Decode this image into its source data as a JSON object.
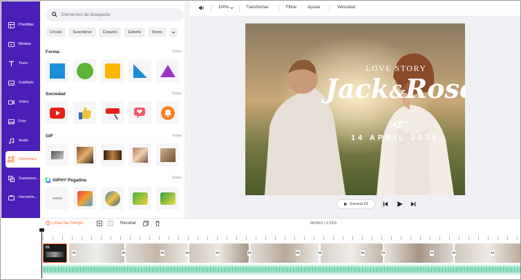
{
  "search": {
    "placeholder": "Elementos de búsqueda"
  },
  "nav": [
    {
      "label": "Plantillas",
      "icon": "templates-icon"
    },
    {
      "label": "Medios",
      "icon": "media-icon"
    },
    {
      "label": "Texto",
      "icon": "text-icon"
    },
    {
      "label": "Subtítulo",
      "icon": "subtitle-icon"
    },
    {
      "label": "Vídeo",
      "icon": "video-icon"
    },
    {
      "label": "Foto",
      "icon": "photo-icon"
    },
    {
      "label": "Audio",
      "icon": "audio-icon"
    },
    {
      "label": "Elementos",
      "icon": "elements-icon"
    },
    {
      "label": "Superposi...",
      "icon": "overlay-icon"
    },
    {
      "label": "Herramie...",
      "icon": "tools-icon"
    }
  ],
  "chips": [
    "Círculo",
    "Suscribirse",
    "Corazón",
    "Estrella",
    "Flores"
  ],
  "sections": {
    "forma": {
      "title": "Forma",
      "all": "Todas"
    },
    "sociedad": {
      "title": "Sociedad",
      "all": "Todas"
    },
    "gif": {
      "title": "GIF",
      "all": "Todas"
    },
    "giphy": {
      "title": "GIPHY Pegatina",
      "all": "Todas"
    }
  },
  "toolbar": {
    "zoom": "100%",
    "transform": "Transformar",
    "crop": "Filtrar",
    "adjust": "Ajustar",
    "speed": "Velocidad"
  },
  "video": {
    "line1": "LOVE STORY",
    "name1": "Jack",
    "amp": "&",
    "name2": "Rose",
    "date": "14 APRIL 2023"
  },
  "controls": {
    "scene": "Escena 01"
  },
  "timeline": {
    "tab": "Línea De Tiempo",
    "split": "Recortar",
    "time": "00:00.0 / 1:23.5",
    "clip_num": "01"
  },
  "colors": {
    "nav_bg": "#4a1fb8",
    "accent": "#ff6a2b",
    "audio": "#5ed6a3"
  }
}
